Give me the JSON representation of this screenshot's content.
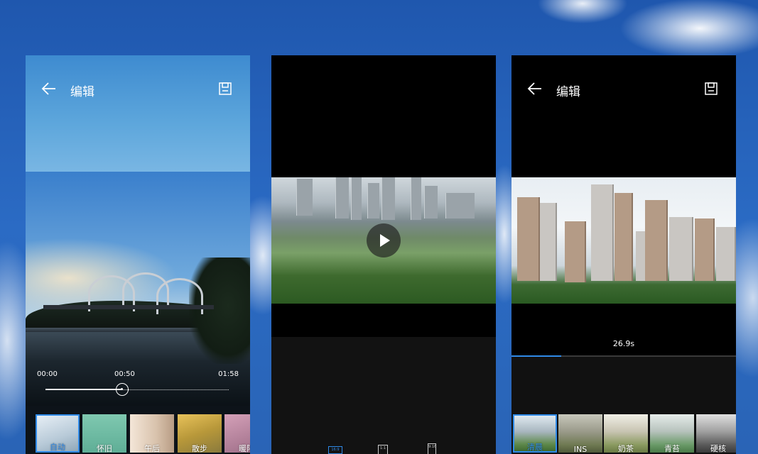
{
  "left_screen": {
    "title": "编辑",
    "time_start": "00:00",
    "time_current": "00:50",
    "time_end": "01:58",
    "progress_fraction": 0.42,
    "filters": [
      {
        "label": "自动",
        "selected": true
      },
      {
        "label": "怀旧",
        "selected": false
      },
      {
        "label": "午后",
        "selected": false
      },
      {
        "label": "散步",
        "selected": false
      },
      {
        "label": "暖阳",
        "selected": false
      }
    ]
  },
  "middle_screen": {
    "play_icon": "play-icon",
    "ratios": [
      {
        "label": "16:9",
        "active": true
      },
      {
        "label": "1:1",
        "active": false
      },
      {
        "label": "9:16",
        "active": false
      }
    ]
  },
  "right_screen": {
    "title": "编辑",
    "duration": "26.9s",
    "progress_fraction": 0.22,
    "filters": [
      {
        "label": "清晨",
        "selected": true
      },
      {
        "label": "INS",
        "selected": false
      },
      {
        "label": "奶茶",
        "selected": false
      },
      {
        "label": "青苔",
        "selected": false
      },
      {
        "label": "硬核",
        "selected": false
      }
    ]
  },
  "colors": {
    "accent": "#2f8ae8",
    "panel_dark": "#111111"
  }
}
